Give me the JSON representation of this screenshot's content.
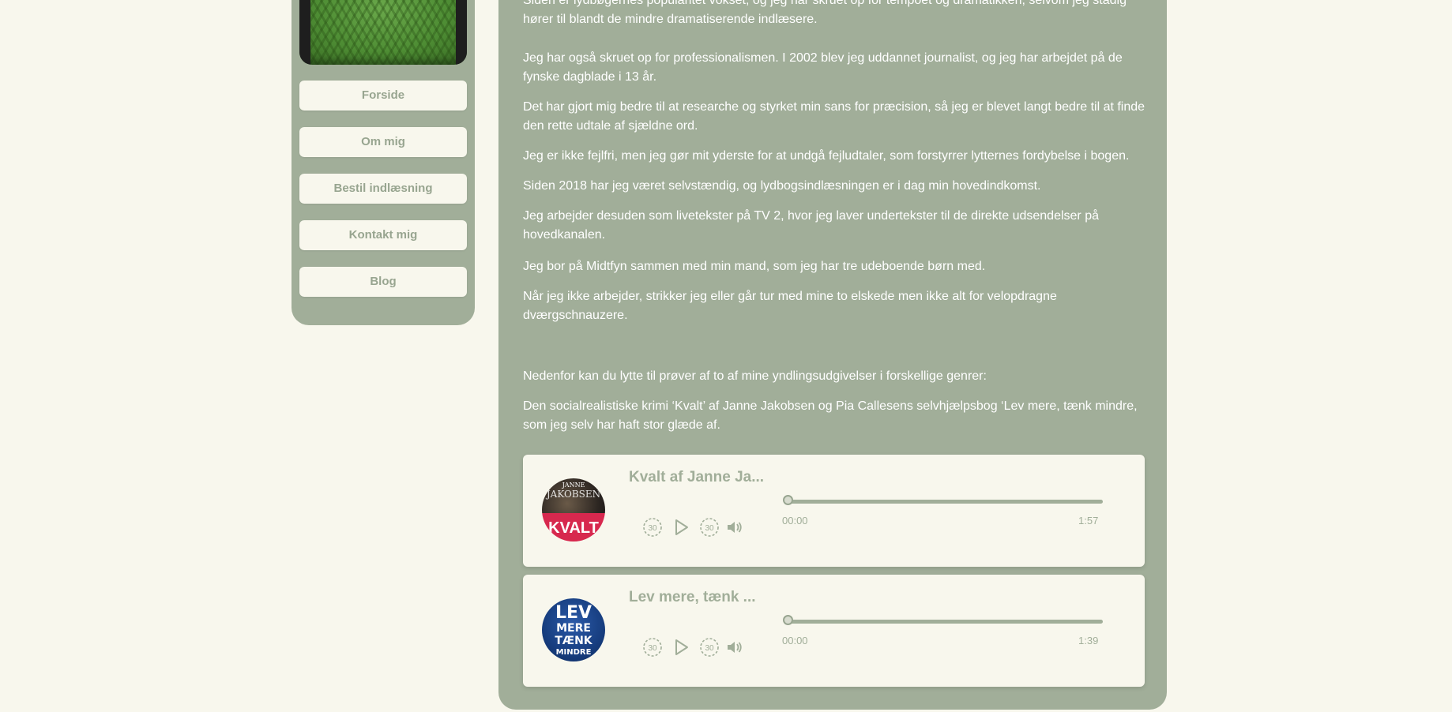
{
  "sidebar": {
    "nav": [
      "Forside",
      "Om mig",
      "Bestil indlæsning",
      "Kontakt mig",
      "Blog"
    ]
  },
  "content": {
    "paragraphs": [
      "Siden er lydbøgernes popularitet vokset, og jeg har skruet op for tempoet og dramatikken, selvom jeg stadig hører til blandt de mindre dramatiserende indlæsere.",
      "Jeg har også skruet op for professionalismen. I 2002 blev jeg uddannet journalist, og jeg har arbejdet på de fynske dagblade i 13 år.",
      "Det har gjort mig bedre til at researche og styrket min sans for præcision, så jeg er blevet langt bedre til at finde den rette udtale af sjældne ord.",
      "Jeg er ikke fejlfri, men jeg gør mit yderste for at undgå fejludtaler, som forstyrrer lytternes fordybelse i bogen.",
      "Siden 2018 har jeg været selvstændig, og lydbogsindlæsningen er i dag min hovedindkomst.",
      "Jeg arbejder desuden som livetekster på TV 2, hvor jeg laver undertekster til de direkte udsendelser på hovedkanalen.",
      "Jeg bor på Midtfyn sammen med min mand, som jeg har tre udeboende børn med.",
      "Når jeg ikke arbejder, strikker jeg eller går tur med mine to elskede men ikke alt for velopdragne dværgschnauzere.",
      "Nedenfor kan du lytte til prøver af to af mine yndlingsudgivelser i forskellige genrer:",
      "Den socialrealistiske krimi ‘Kvalt’ af Janne Jakobsen og Pia Callesens selvhjælpsbog ‘Lev mere, tænk mindre, som jeg selv har haft stor glæde af."
    ]
  },
  "players": [
    {
      "title": "Kvalt af Janne Ja...",
      "cover_text": [
        "JANNE",
        "JAKOBSEN",
        "KVALT"
      ],
      "current": "00:00",
      "duration": "1:57",
      "progress": 0
    },
    {
      "title": "Lev mere, tænk ...",
      "cover_text": [
        "LEV",
        "MERE",
        "TÆNK",
        "MINDRE"
      ],
      "current": "00:00",
      "duration": "1:39",
      "progress": 0
    }
  ],
  "controls": {
    "rewind_label": "30",
    "forward_label": "30"
  },
  "colors": {
    "page_bg": "#f8f7ed",
    "panel": "#a1ae99",
    "accent_text": "#98a590"
  },
  "icons": [
    "rewind-30-icon",
    "play-icon",
    "forward-30-icon",
    "volume-icon"
  ]
}
